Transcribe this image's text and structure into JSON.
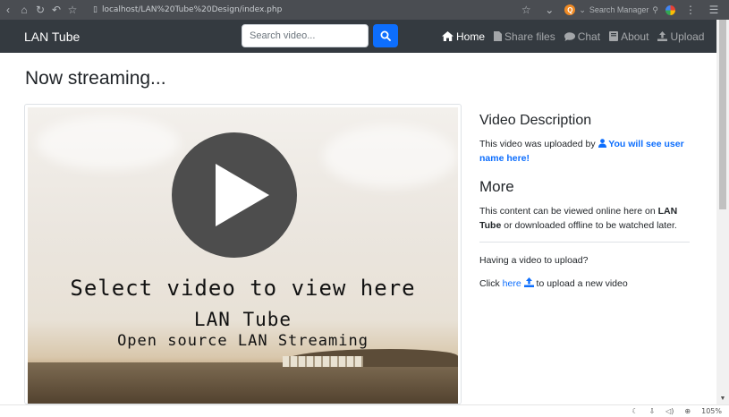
{
  "browser": {
    "url": "localhost/LAN%20Tube%20Design/index.php",
    "search_placeholder": "Search Manager",
    "zoom": "105%"
  },
  "navbar": {
    "brand": "LAN Tube",
    "search_placeholder": "Search video...",
    "links": [
      {
        "label": "Home",
        "icon": "home-icon",
        "active": true
      },
      {
        "label": "Share files",
        "icon": "file-icon",
        "active": false
      },
      {
        "label": "Chat",
        "icon": "chat-icon",
        "active": false
      },
      {
        "label": "About",
        "icon": "book-icon",
        "active": false
      },
      {
        "label": "Upload",
        "icon": "upload-icon",
        "active": false
      }
    ]
  },
  "main": {
    "title": "Now streaming...",
    "video": {
      "line1": "Select video to view here",
      "line2": "LAN Tube",
      "line3": "Open source LAN Streaming"
    }
  },
  "sidebar": {
    "desc_heading": "Video Description",
    "desc_text": "This video was uploaded by",
    "desc_user": "You will see user name here!",
    "more_heading": "More",
    "more_text_pre": "This content can be viewed online here on",
    "more_text_bold": "LAN Tube",
    "more_text_post": "or downloaded offline to be watched later.",
    "upload_question": "Having a video to upload?",
    "click_pre": "Click",
    "click_link": "here",
    "click_post": "to upload a new video"
  },
  "colors": {
    "navbar_bg": "#343a40",
    "primary": "#0d6efd"
  }
}
